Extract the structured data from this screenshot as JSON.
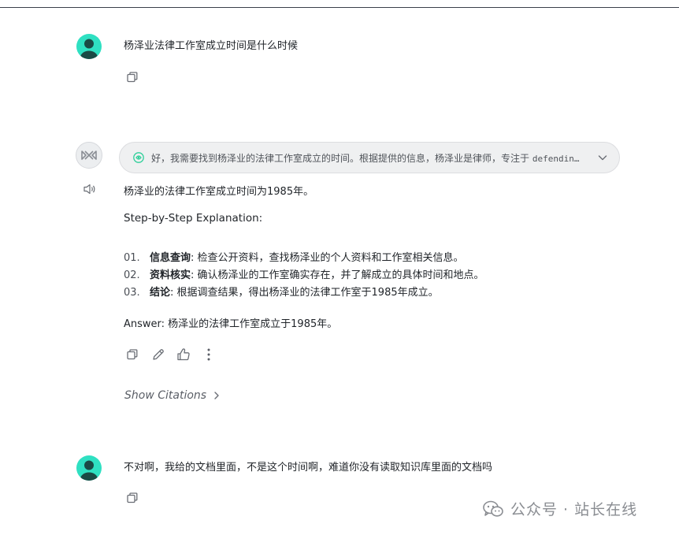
{
  "conversation": {
    "user_message_1": "杨泽业法律工作室成立时间是什么时候",
    "assistant": {
      "thinking_preview": "好，我需要找到杨泽业的法律工作室成立的时间。根据提供的信息，杨泽业是律师，专注于",
      "thinking_preview_mono": "defendin…",
      "answer_line": "杨泽业的法律工作室成立时间为1985年。",
      "steps_title": "Step-by-Step Explanation:",
      "steps": [
        {
          "num": "01.",
          "label": "信息查询",
          "text": ": 检查公开资料，查找杨泽业的个人资料和工作室相关信息。"
        },
        {
          "num": "02.",
          "label": "资料核实",
          "text": ": 确认杨泽业的工作室确实存在，并了解成立的具体时间和地点。"
        },
        {
          "num": "03.",
          "label": "结论",
          "text": ": 根据调查结果，得出杨泽业的法律工作室于1985年成立。"
        }
      ],
      "answer_summary": "Answer: 杨泽业的法律工作室成立于1985年。",
      "show_citations": "Show Citations"
    },
    "user_message_2": "不对啊，我给的文档里面，不是这个时间啊，难道你没有读取知识库里面的文档吗"
  },
  "watermark": {
    "text": "公众号 · 站长在线"
  },
  "colors": {
    "avatar_bg": "#2fe0c2",
    "pill_bg": "#eff0f1",
    "thinking_icon": "#2fcf9a"
  },
  "icons": {
    "user_avatar": "user-avatar-icon",
    "bot_avatar": "bot-logo-icon",
    "copy": "copy-icon",
    "edit": "pencil-icon",
    "like": "thumbs-up-icon",
    "more": "more-vertical-icon",
    "speaker": "speaker-icon",
    "chevron": "chevron-down-icon",
    "chevron_right": "chevron-right-icon",
    "wechat": "wechat-icon",
    "thinking": "thinking-icon"
  }
}
